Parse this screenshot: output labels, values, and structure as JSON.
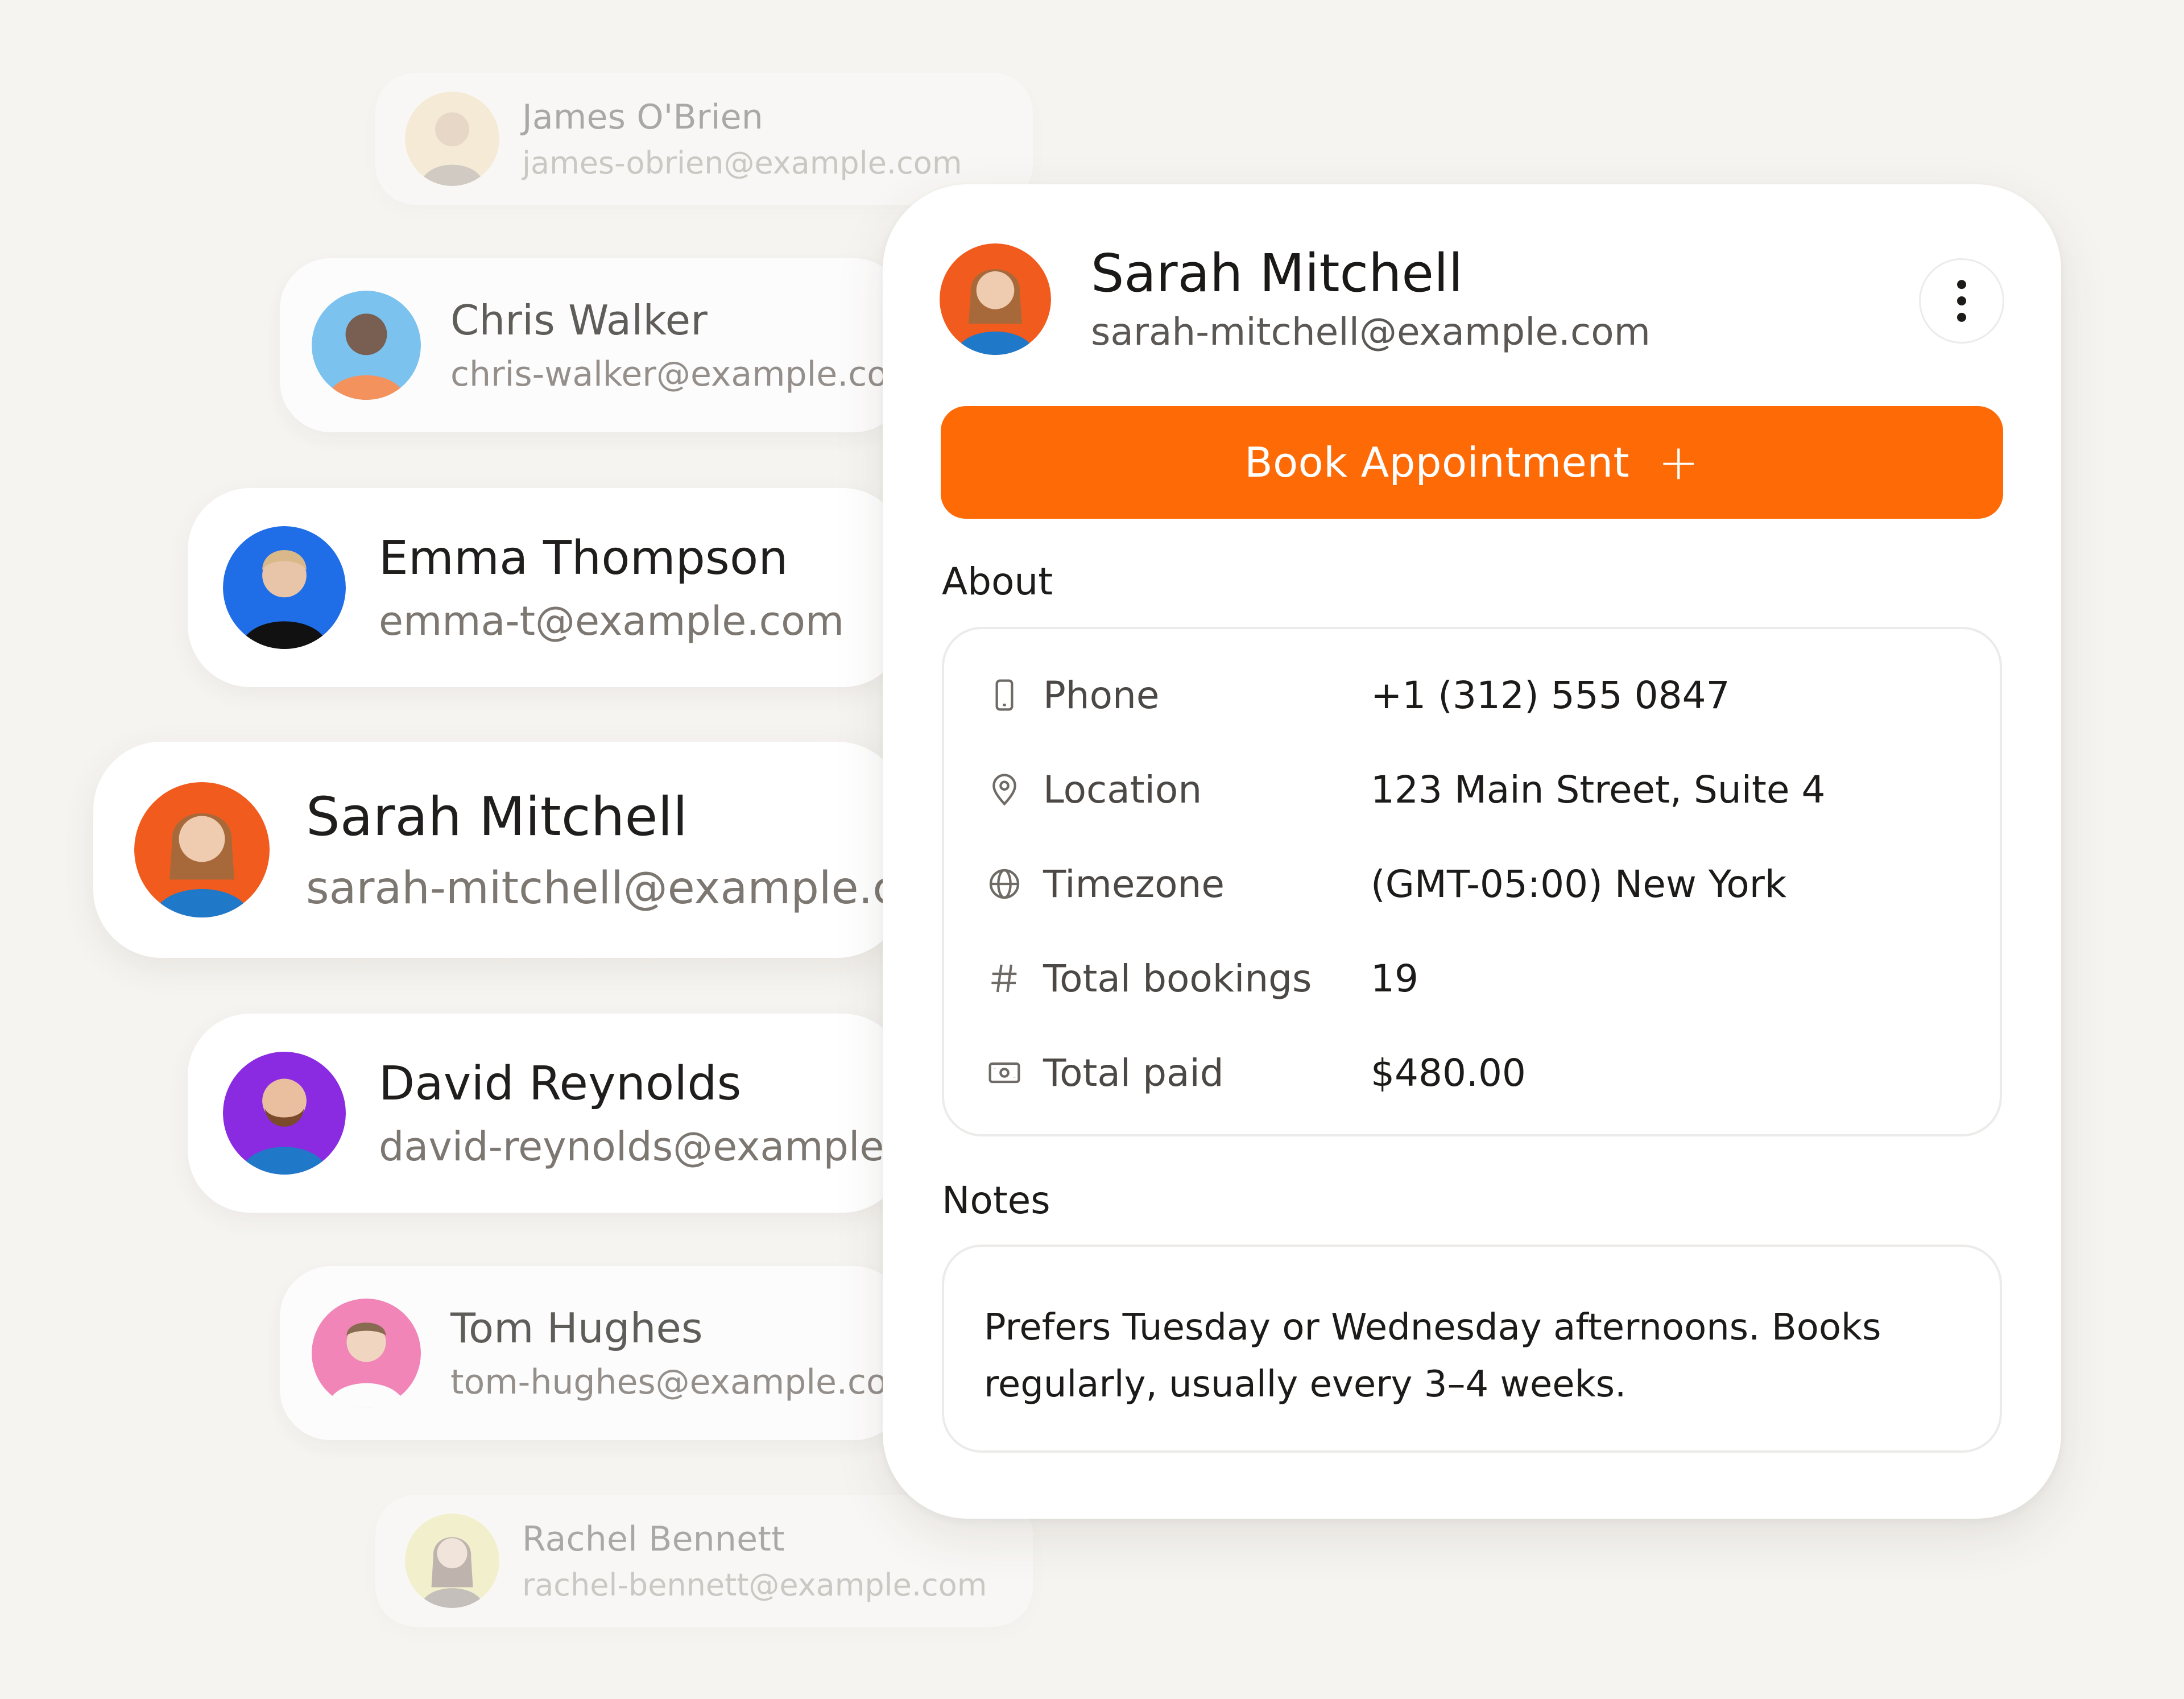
{
  "contacts": [
    {
      "name": "James O'Brien",
      "email": "james-obrien@example.com"
    },
    {
      "name": "Chris Walker",
      "email": "chris-walker@example.com"
    },
    {
      "name": "Emma Thompson",
      "email": "emma-t@example.com"
    },
    {
      "name": "Sarah Mitchell",
      "email": "sarah-mitchell@example.com"
    },
    {
      "name": "David Reynolds",
      "email": "david-reynolds@example.com"
    },
    {
      "name": "Tom Hughes",
      "email": "tom-hughes@example.com"
    },
    {
      "name": "Rachel Bennett",
      "email": "rachel-bennett@example.com"
    }
  ],
  "detail": {
    "name": "Sarah Mitchell",
    "email": "sarah-mitchell@example.com",
    "more_icon": "more-vertical-icon",
    "book_label": "Book Appointment",
    "book_plus": "+",
    "about_title": "About",
    "about": [
      {
        "icon": "phone-icon",
        "label": "Phone",
        "value": "+1 (312) 555 0847"
      },
      {
        "icon": "location-pin-icon",
        "label": "Location",
        "value": "123 Main Street, Suite 4"
      },
      {
        "icon": "globe-icon",
        "label": "Timezone",
        "value": "(GMT-05:00) New York"
      },
      {
        "icon": "hash-icon",
        "label": "Total bookings",
        "value": "19"
      },
      {
        "icon": "cash-icon",
        "label": "Total paid",
        "value": "$480.00"
      }
    ],
    "notes_title": "Notes",
    "notes_text": "Prefers Tuesday or Wednesday afternoons. Books regularly, usually every 3–4 weeks."
  },
  "colors": {
    "accent": "#fe6a06",
    "background": "#f6f4f1",
    "avatar_james": "#f3d9a6",
    "avatar_chris": "#5db8ee",
    "avatar_emma": "#1f6ee8",
    "avatar_sarah": "#f25b1e",
    "avatar_david": "#8a2be2",
    "avatar_tom": "#f06aaa",
    "avatar_rachel": "#ede78d"
  }
}
